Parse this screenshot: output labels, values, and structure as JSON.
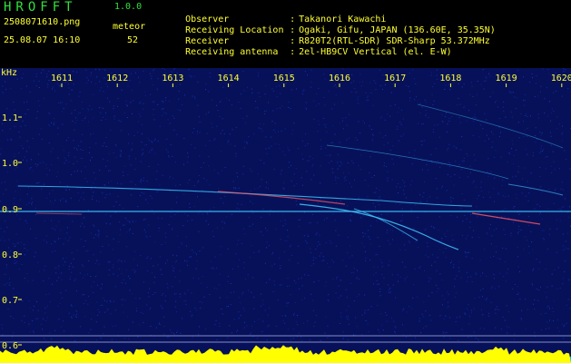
{
  "header": {
    "app_title": "HROFFT",
    "app_version": "1.0.0",
    "filename": "2508071610.png",
    "datetime": "25.08.07 16:10",
    "mode_label": "meteor",
    "event_count": "52"
  },
  "meta": [
    {
      "label": "Observer",
      "value": "Takanori Kawachi"
    },
    {
      "label": "Receiving Location",
      "value": "Ogaki, Gifu, JAPAN (136.60E, 35.35N)"
    },
    {
      "label": "Receiver",
      "value": "R820T2(RTL-SDR) SDR-Sharp 53.372MHz"
    },
    {
      "label": "Receiving antenna",
      "value": "2el-HB9CV Vertical (el. E-W)"
    }
  ],
  "spectrogram": {
    "y_unit": "kHz",
    "y_ticks": [
      "1.1",
      "1.0",
      "0.9",
      "0.8",
      "0.7",
      "0.6"
    ],
    "x_ticks": [
      "1611",
      "1612",
      "1613",
      "1614",
      "1615",
      "1616",
      "1617",
      "1618",
      "1619",
      "1620"
    ],
    "colors": {
      "background": "#07115a",
      "noise": "#1a3fd0",
      "trace": "#3fc9ff",
      "hot": "#ff5a66",
      "axis_text": "#ffff33",
      "level_fill": "#ffff00",
      "level_base": "#00b4ff"
    }
  }
}
